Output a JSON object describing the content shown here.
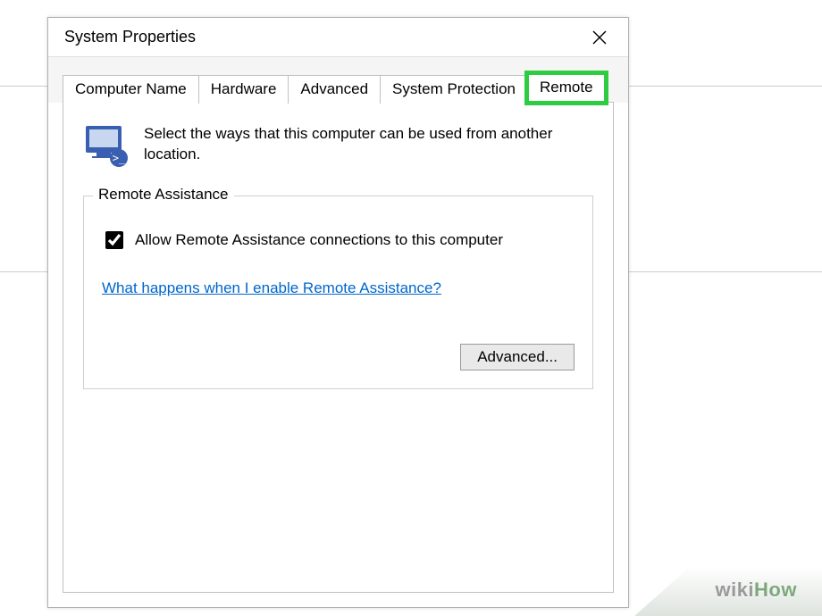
{
  "background": {
    "lines_y": [
      96,
      304
    ]
  },
  "dialog": {
    "title": "System Properties",
    "tabs": [
      {
        "label": "Computer Name",
        "active": false,
        "highlight": false
      },
      {
        "label": "Hardware",
        "active": false,
        "highlight": false
      },
      {
        "label": "Advanced",
        "active": false,
        "highlight": false
      },
      {
        "label": "System Protection",
        "active": false,
        "highlight": false
      },
      {
        "label": "Remote",
        "active": true,
        "highlight": true
      }
    ],
    "intro_text": "Select the ways that this computer can be used from another location.",
    "group": {
      "title": "Remote Assistance",
      "checkbox_label": "Allow Remote Assistance connections to this computer",
      "checkbox_checked": true,
      "help_link": "What happens when I enable Remote Assistance?",
      "advanced_button": "Advanced..."
    }
  },
  "watermark": {
    "wiki": "wiki",
    "how": "How"
  }
}
